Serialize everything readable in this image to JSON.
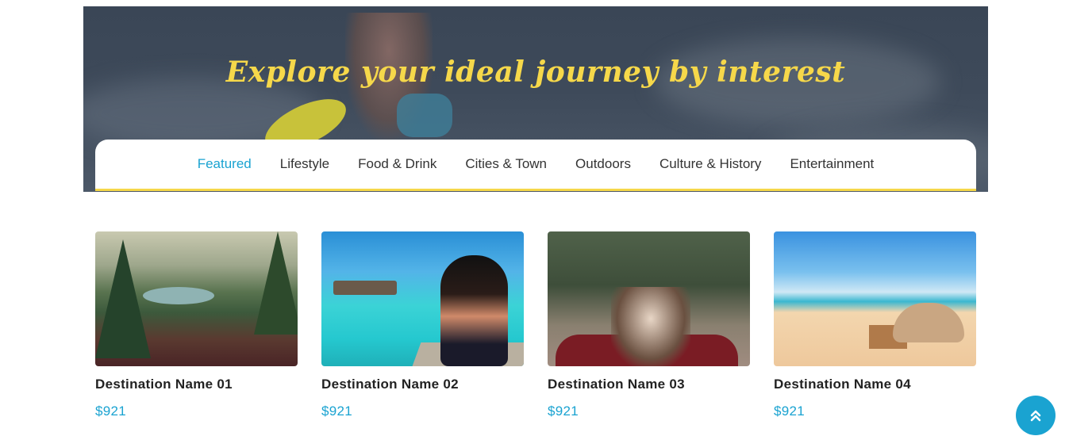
{
  "hero": {
    "title": "Explore your ideal journey by interest"
  },
  "tabs": [
    {
      "label": "Featured",
      "active": true
    },
    {
      "label": "Lifestyle",
      "active": false
    },
    {
      "label": "Food & Drink",
      "active": false
    },
    {
      "label": "Cities & Town",
      "active": false
    },
    {
      "label": "Outdoors",
      "active": false
    },
    {
      "label": "Culture & History",
      "active": false
    },
    {
      "label": "Entertainment",
      "active": false
    }
  ],
  "cards": [
    {
      "name": "Destination Name 01",
      "price": "$921"
    },
    {
      "name": "Destination Name 02",
      "price": "$921"
    },
    {
      "name": "Destination Name 03",
      "price": "$921"
    },
    {
      "name": "Destination Name 04",
      "price": "$921"
    }
  ],
  "scroll_top": {
    "icon": "double-chevron-up-icon"
  },
  "colors": {
    "accent": "#1aa3d1",
    "heading_yellow": "#f6d84a",
    "text_dark": "#222222"
  }
}
